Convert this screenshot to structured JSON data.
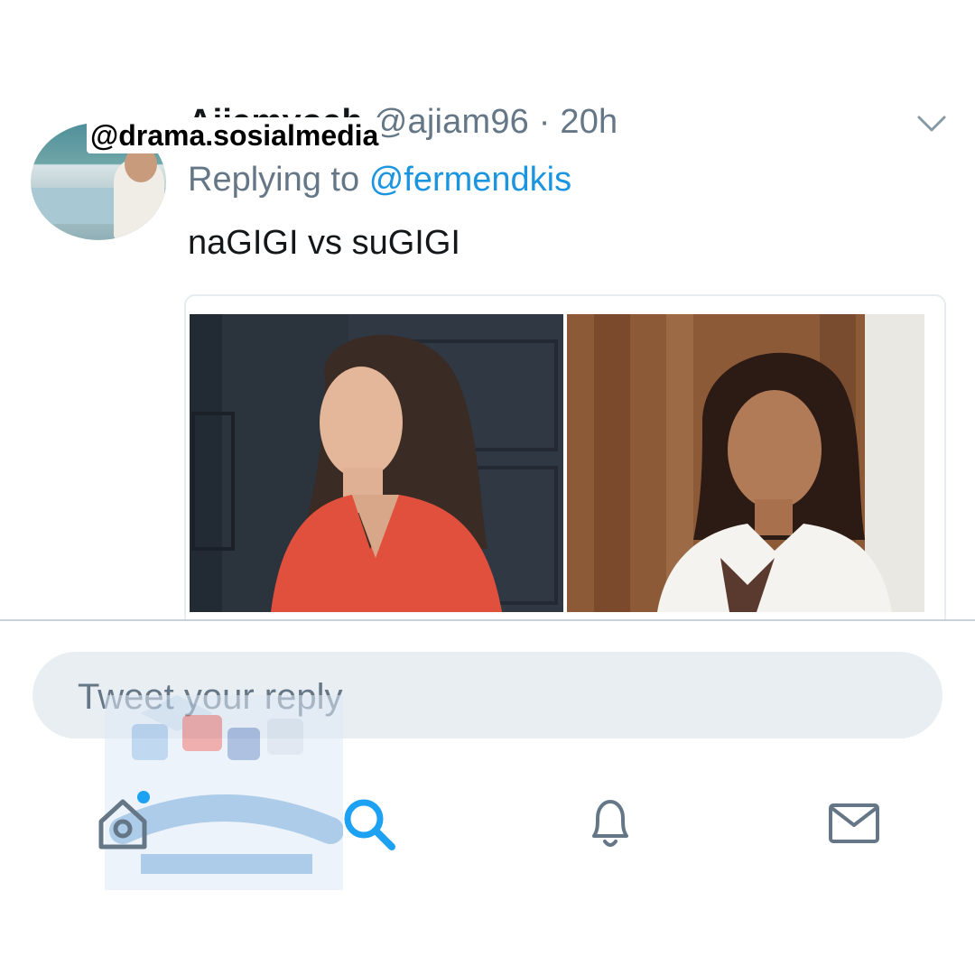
{
  "tweet": {
    "author_name": "Ajiamyoah",
    "author_handle": "@ajiam96",
    "separator": "·",
    "timestamp": "20h",
    "replying_label": "Replying to",
    "replying_to": "@fermendkis",
    "text": "naGIGI vs suGIGI",
    "images": [
      "woman-in-red-dress-photo",
      "woman-in-white-blouse-photo"
    ]
  },
  "watermark": {
    "handle": "@drama.sosialmedia",
    "logo_title": "DRAMA",
    "logo_subtitle": "SOSIAL MEDIA"
  },
  "reply": {
    "placeholder": "Tweet your reply"
  },
  "nav": {
    "items": [
      "home-icon",
      "search-icon",
      "notifications-icon",
      "messages-icon"
    ],
    "active": "search-icon",
    "accent": "#1da1f2",
    "inactive_color": "#657786"
  },
  "colors": {
    "mention": "#1b95e0",
    "secondary_text": "#657786",
    "primary_text": "#14171a"
  }
}
